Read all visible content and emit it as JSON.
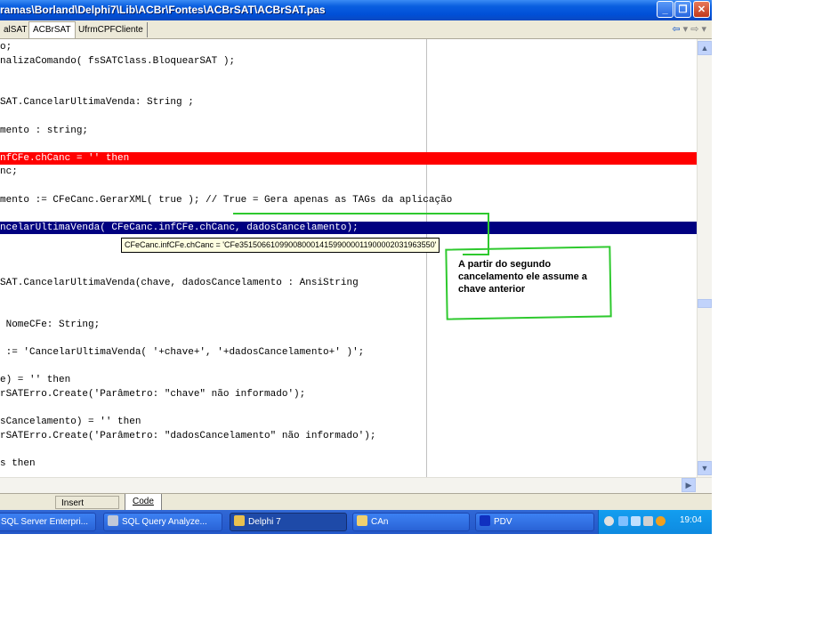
{
  "window": {
    "title": "ramas\\Borland\\Delphi7\\Lib\\ACBr\\Fontes\\ACBrSAT\\ACBrSAT.pas"
  },
  "tabs": [
    "alSAT",
    "ACBrSAT",
    "UfrmCPFCliente"
  ],
  "code_lines": [
    {
      "text": "o;",
      "style": ""
    },
    {
      "text": "nalizaComando( fsSATClass.BloquearSAT );",
      "style": ""
    },
    {
      "text": "",
      "style": ""
    },
    {
      "text": "",
      "style": ""
    },
    {
      "text": "SAT.CancelarUltimaVenda: String ;",
      "style": ""
    },
    {
      "text": "",
      "style": ""
    },
    {
      "text": "mento : string;",
      "style": ""
    },
    {
      "text": "",
      "style": ""
    },
    {
      "text": "nfCFe.chCanc = '' then",
      "style": "err"
    },
    {
      "text": "nc;",
      "style": ""
    },
    {
      "text": "",
      "style": ""
    },
    {
      "text": "mento := CFeCanc.GerarXML( true ); // True = Gera apenas as TAGs da aplicação",
      "style": ""
    },
    {
      "text": "",
      "style": ""
    },
    {
      "text": "ncelarUltimaVenda( CFeCanc.infCFe.chCanc, dadosCancelamento);",
      "style": "exec"
    },
    {
      "text": "",
      "style": ""
    },
    {
      "text": "",
      "style": ""
    },
    {
      "text": "",
      "style": ""
    },
    {
      "text": "SAT.CancelarUltimaVenda(chave, dadosCancelamento : AnsiString",
      "style": ""
    },
    {
      "text": "",
      "style": ""
    },
    {
      "text": "",
      "style": ""
    },
    {
      "text": " NomeCFe: String;",
      "style": ""
    },
    {
      "text": "",
      "style": ""
    },
    {
      "text": " := 'CancelarUltimaVenda( '+chave+', '+dadosCancelamento+' )';",
      "style": ""
    },
    {
      "text": "",
      "style": ""
    },
    {
      "text": "e) = '' then",
      "style": ""
    },
    {
      "text": "rSATErro.Create('Parâmetro: \"chave\" não informado');",
      "style": ""
    },
    {
      "text": "",
      "style": ""
    },
    {
      "text": "sCancelamento) = '' then",
      "style": ""
    },
    {
      "text": "rSATErro.Create('Parâmetro: \"dadosCancelamento\" não informado');",
      "style": ""
    },
    {
      "text": "",
      "style": ""
    },
    {
      "text": "s then",
      "style": ""
    }
  ],
  "tooltip": {
    "text": "CFeCanc.infCFe.chCanc = 'CFe35150661099008000141599000011900002031963550'"
  },
  "annotation": {
    "text": "A partir do segundo cancelamento ele assume a chave anterior",
    "color": "#2ec92e"
  },
  "status": {
    "mode": "Insert",
    "tab": "Code"
  },
  "taskbar": {
    "items": [
      {
        "label": "SQL Server Enterpri...",
        "icon": "sql-server-icon"
      },
      {
        "label": "SQL Query Analyze...",
        "icon": "query-analyzer-icon"
      },
      {
        "label": "Delphi 7",
        "icon": "delphi-icon"
      },
      {
        "label": "CAn",
        "icon": "folder-icon"
      },
      {
        "label": "PDV",
        "icon": "pdv-icon"
      }
    ],
    "time": "19:04"
  }
}
